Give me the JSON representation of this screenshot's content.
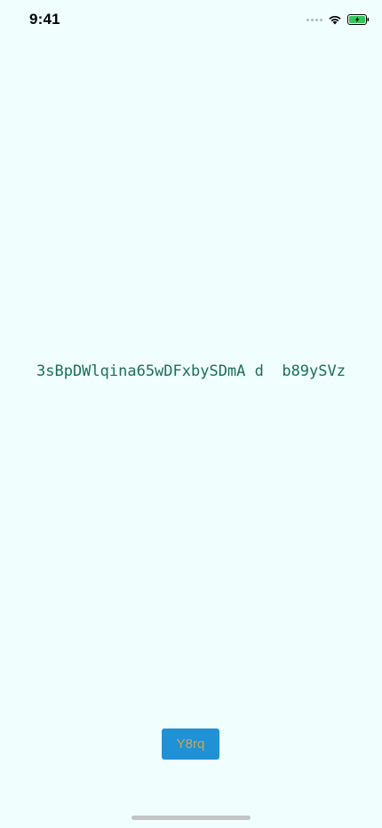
{
  "status_bar": {
    "time": "9:41"
  },
  "main": {
    "text": "3sBpDWlqina65wDFxbySDmA d  b89ySVz",
    "button_label": "Y8rq"
  },
  "colors": {
    "background": "#f0fffe",
    "text": "#1a6e5a",
    "button_bg": "#2191d6",
    "button_text": "#c8a84a",
    "battery_fill": "#34c759"
  },
  "icons": {
    "signal": "signal-dots-icon",
    "wifi": "wifi-icon",
    "battery": "battery-charging-icon"
  }
}
